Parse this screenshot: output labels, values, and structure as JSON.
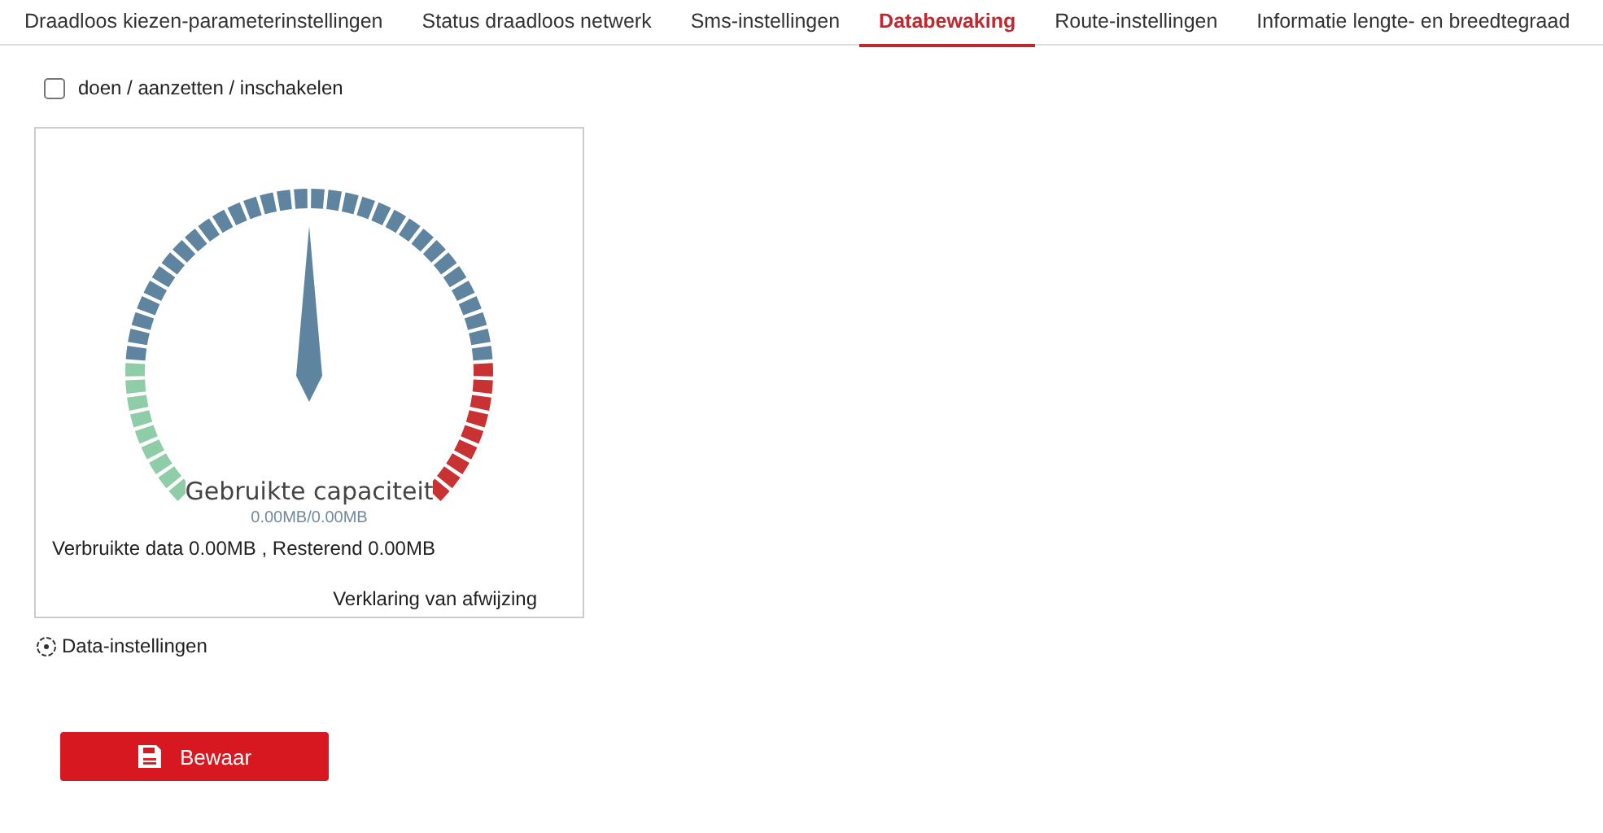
{
  "tabs": [
    {
      "label": "Draadloos kiezen-parameterinstellingen",
      "selected": false
    },
    {
      "label": "Status draadloos netwerk",
      "selected": false
    },
    {
      "label": "Sms-instellingen",
      "selected": false
    },
    {
      "label": "Databewaking",
      "selected": true
    },
    {
      "label": "Route-instellingen",
      "selected": false
    },
    {
      "label": "Informatie lengte- en breedtegraad",
      "selected": false
    }
  ],
  "enable": {
    "label": "doen / aanzetten / inschakelen",
    "checked": false
  },
  "gauge": {
    "title": "Gebruikte capaciteit",
    "reading": "0.00MB/0.00MB",
    "usage": "Verbruikte data 0.00MB , Resterend 0.00MB",
    "disclaimer": "Verklaring van afwijzing"
  },
  "settings_link": "Data-instellingen",
  "save_button": "Bewaar"
}
